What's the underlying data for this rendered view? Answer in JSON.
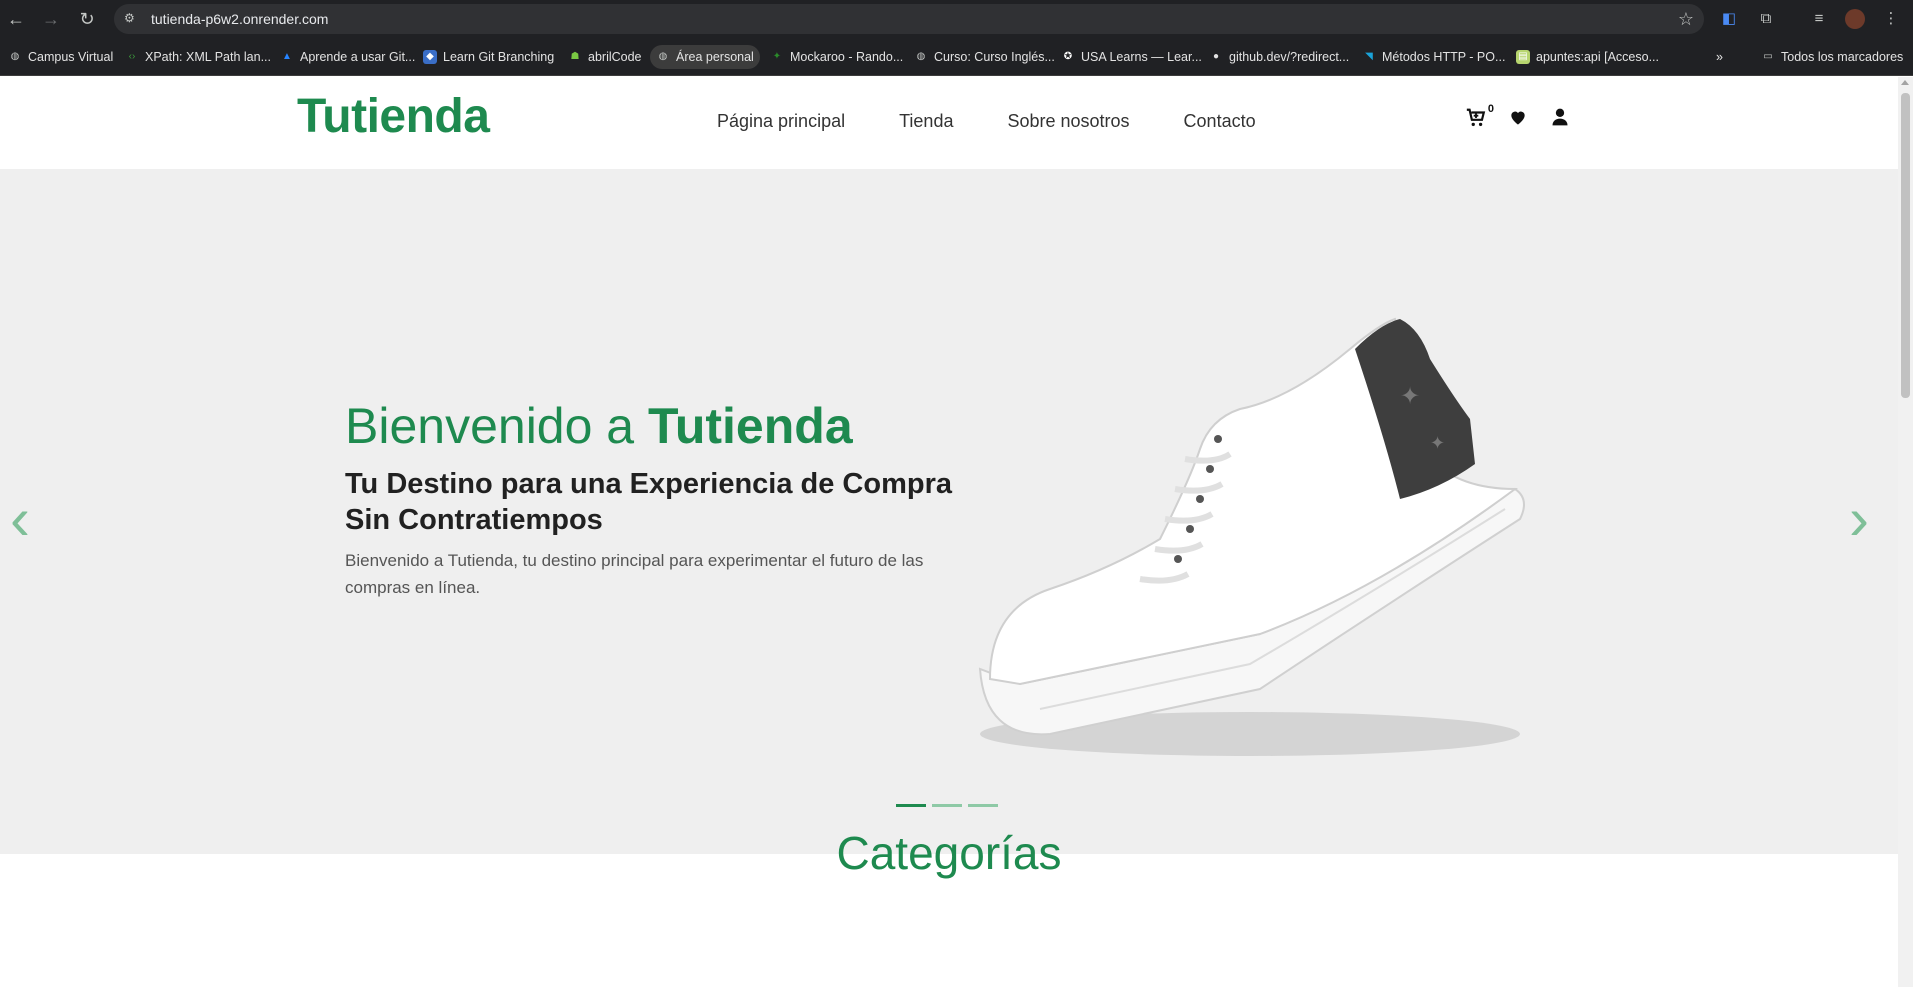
{
  "browser": {
    "url": "tutienda-p6w2.onrender.com",
    "bookmarks": [
      {
        "label": "Campus Virtual",
        "icon": "globe-icon"
      },
      {
        "label": "XPath: XML Path lan...",
        "icon": "code-icon"
      },
      {
        "label": "Aprende a usar Git...",
        "icon": "atlassian-icon"
      },
      {
        "label": "Learn Git Branching",
        "icon": "git-icon"
      },
      {
        "label": "abrilCode",
        "icon": "android-icon"
      },
      {
        "label": "Área personal",
        "icon": "globe-icon"
      },
      {
        "label": "Mockaroo - Rando...",
        "icon": "mockaroo-icon"
      },
      {
        "label": "Curso: Curso Inglés...",
        "icon": "globe-icon"
      },
      {
        "label": "USA Learns — Lear...",
        "icon": "star-icon"
      },
      {
        "label": "github.dev/?redirect...",
        "icon": "github-icon"
      },
      {
        "label": "Métodos HTTP - PO...",
        "icon": "postman-icon"
      },
      {
        "label": "apuntes:api [Acceso...",
        "icon": "doc-icon"
      }
    ],
    "all_bookmarks_label": "Todos los marcadores"
  },
  "header": {
    "logo": "Tutienda",
    "menu": [
      "Página principal",
      "Tienda",
      "Sobre nosotros",
      "Contacto"
    ],
    "cart_count": "0"
  },
  "hero": {
    "title_light": "Bienvenido a ",
    "title_bold": "Tutienda",
    "subtitle": "Tu Destino para una Experiencia de Compra Sin Contratiempos",
    "text": "Bienvenido a Tutienda, tu destino principal para experimentar el futuro de las compras en línea.",
    "prev_arrow": "‹",
    "next_arrow": "›"
  },
  "categories": {
    "title": "Categorías"
  },
  "colors": {
    "brand": "#1e8a4f",
    "hero_bg": "#efefef"
  }
}
